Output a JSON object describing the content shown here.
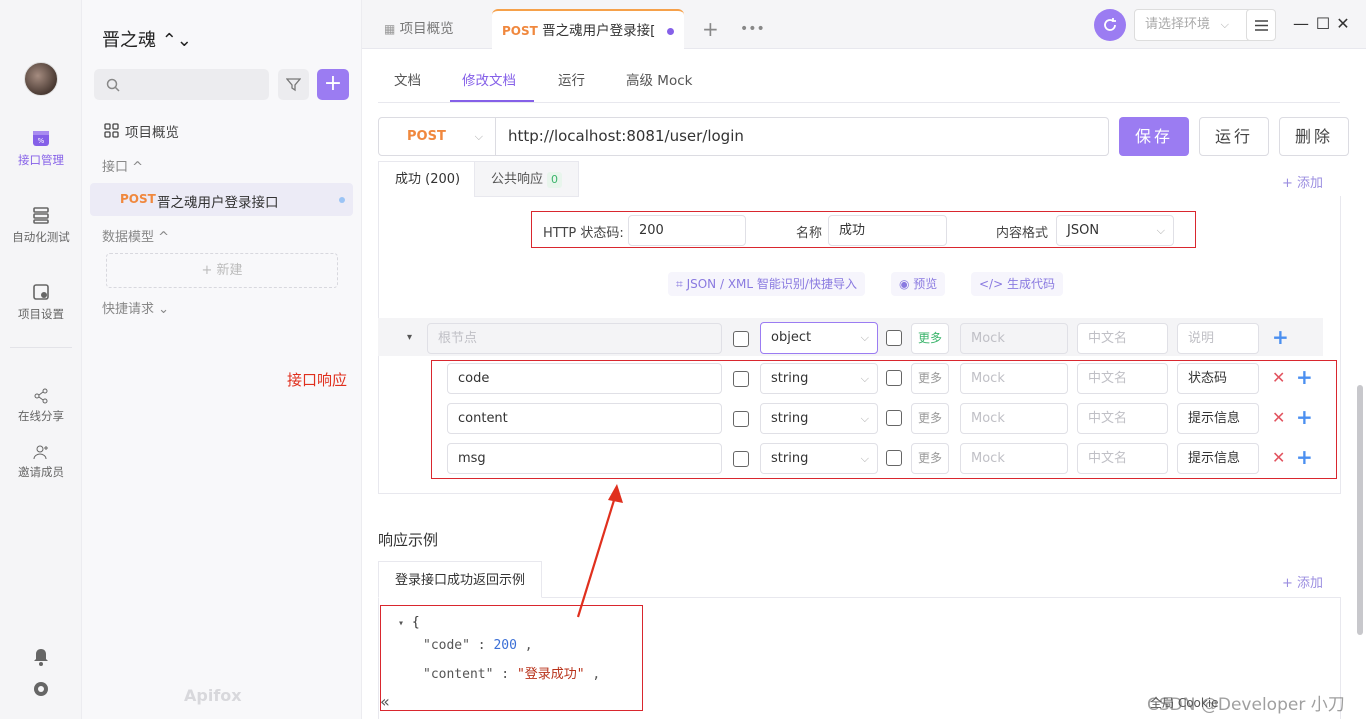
{
  "rail": {
    "items": [
      {
        "label": "接口管理"
      },
      {
        "label": "自动化测试"
      },
      {
        "label": "项目设置"
      },
      {
        "label": "在线分享"
      },
      {
        "label": "邀请成员"
      }
    ]
  },
  "side": {
    "project_name": "晋之魂 ⌃⌄",
    "overview": "项目概览",
    "section_api": "接口 ^",
    "api_method": "POST",
    "api_name": "晋之魂用户登录接口",
    "section_model": "数据模型 ^",
    "new_label": "+ 新建",
    "section_quick": "快捷请求 ⌄",
    "logo": "Apifox",
    "annotation": "接口响应"
  },
  "tabs": {
    "overview": "项目概览",
    "active_method": "POST",
    "active_name": "晋之魂用户登录接[",
    "env_placeholder": "请选择环境"
  },
  "subtabs": [
    "文档",
    "修改文档",
    "运行",
    "高级 Mock"
  ],
  "request": {
    "method": "POST",
    "url": "http://localhost:8081/user/login",
    "save": "保存",
    "run": "运行",
    "delete": "删除"
  },
  "response_tabs": {
    "success": "成功 (200)",
    "public": "公共响应",
    "public_count": "0",
    "add": "+ 添加"
  },
  "response_meta": {
    "status_label": "HTTP 状态码:",
    "status_value": "200",
    "name_label": "名称",
    "name_value": "成功",
    "format_label": "内容格式",
    "format_value": "JSON"
  },
  "tools": {
    "import": "JSON / XML 智能识别/快捷导入",
    "preview": "预览",
    "gen_code": "生成代码"
  },
  "schema": {
    "root_placeholder": "根节点",
    "root_type": "object",
    "more": "更多",
    "mock_placeholder": "Mock",
    "cn_placeholder": "中文名",
    "desc_placeholder": "说明",
    "fields": [
      {
        "name": "code",
        "type": "string",
        "desc": "状态码"
      },
      {
        "name": "content",
        "type": "string",
        "desc": "提示信息"
      },
      {
        "name": "msg",
        "type": "string",
        "desc": "提示信息"
      }
    ]
  },
  "example": {
    "title": "响应示例",
    "tab": "登录接口成功返回示例",
    "add": "+ 添加",
    "code_open": "{",
    "code_key": "\"code\"",
    "code_val": "200",
    "content_key": "\"content\"",
    "content_val": "\"登录成功\""
  },
  "footer": {
    "cookie": "全局 Cookie",
    "watermark": "CSDN @Developer 小刀"
  },
  "colors": {
    "accent": "#9b7cf2",
    "post": "#f0883e",
    "annotation_red": "#d9272e"
  }
}
